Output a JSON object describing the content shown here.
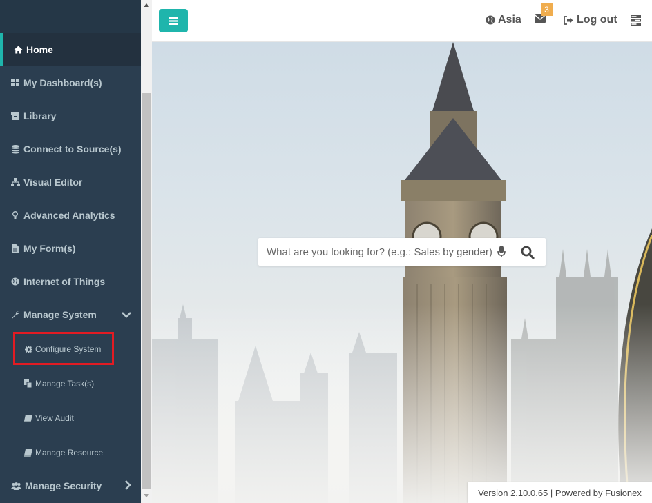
{
  "sidebar": {
    "items": [
      {
        "label": "Home",
        "icon": "home-icon",
        "active": true
      },
      {
        "label": "My Dashboard(s)",
        "icon": "dashboard-icon"
      },
      {
        "label": "Library",
        "icon": "archive-icon"
      },
      {
        "label": "Connect to Source(s)",
        "icon": "database-icon"
      },
      {
        "label": "Visual Editor",
        "icon": "sitemap-icon"
      },
      {
        "label": "Advanced Analytics",
        "icon": "lightbulb-icon"
      },
      {
        "label": "My Form(s)",
        "icon": "file-icon"
      },
      {
        "label": "Internet of Things",
        "icon": "globe-icon"
      },
      {
        "label": "Manage System",
        "icon": "wrench-icon",
        "expanded": true
      },
      {
        "label": "Manage Security",
        "icon": "users-icon"
      }
    ],
    "sub_items": [
      {
        "label": "Configure System",
        "icon": "gear-icon",
        "highlighted": true
      },
      {
        "label": "Manage Task(s)",
        "icon": "copy-icon"
      },
      {
        "label": "View Audit",
        "icon": "book-icon"
      },
      {
        "label": "Manage Resource",
        "icon": "book-icon"
      }
    ]
  },
  "topbar": {
    "region": "Asia",
    "mail_count": "3",
    "logout_label": "Log out"
  },
  "search": {
    "placeholder": "What are you looking for? (e.g.: Sales by gender)"
  },
  "footer": {
    "text": "Version 2.10.0.65 | Powered by Fusionex"
  },
  "colors": {
    "accent": "#1fb5ac",
    "sidebar_bg": "#2b3e50",
    "badge": "#f0ad4e",
    "highlight": "#e31b23"
  }
}
